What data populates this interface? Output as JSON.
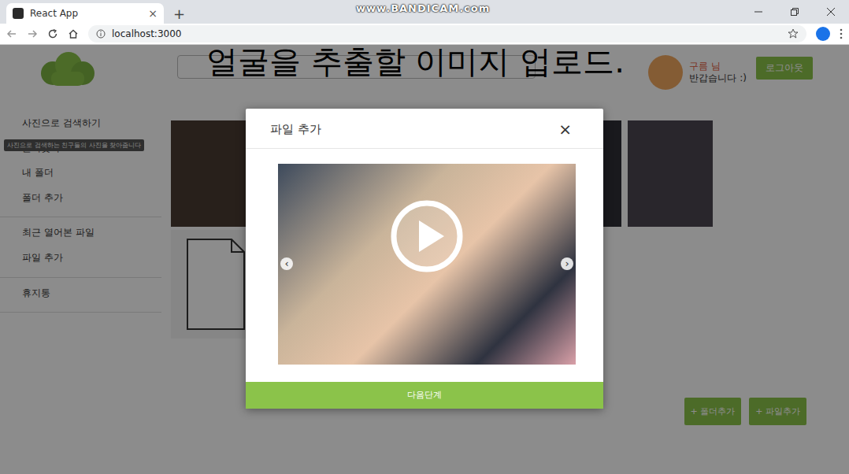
{
  "watermark": "www.BANDICAM.com",
  "browser": {
    "tab": {
      "title": "React App",
      "close": "×"
    },
    "new_tab": "+",
    "address": "localhost:3000"
  },
  "caption": "얼굴을 추출할 이미지 업로드.",
  "header": {
    "user": {
      "name": "구름 님",
      "greeting": "반갑습니다 :)"
    },
    "logout": "로그아웃"
  },
  "sidebar": {
    "groups": [
      [
        "사진으로 검색하기",
        "즐겨찾기",
        "내 폴더",
        "폴더 추가"
      ],
      [
        "최근 열어본 파일",
        "파일 추가"
      ],
      [
        "휴지통"
      ]
    ],
    "tooltip": "사진으로 검색하는 친구들의 사진을 찾아줍니다"
  },
  "actions": [
    "+ 폴더추가",
    "+ 파일추가"
  ],
  "modal": {
    "title": "파일 추가",
    "close": "×",
    "prev": "‹",
    "next": "›",
    "next_step": "다음단계"
  }
}
